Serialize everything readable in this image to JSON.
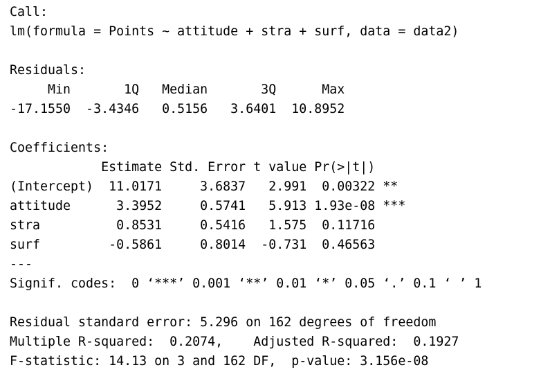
{
  "console": {
    "lines": [
      "Call:",
      "lm(formula = Points ~ attitude + stra + surf, data = data2)",
      "",
      "Residuals:",
      "     Min       1Q   Median       3Q      Max ",
      "-17.1550  -3.4346   0.5156   3.6401  10.8952 ",
      "",
      "Coefficients:",
      "            Estimate Std. Error t value Pr(>|t|)    ",
      "(Intercept)  11.0171     3.6837   2.991  0.00322 ** ",
      "attitude      3.3952     0.5741   5.913 1.93e-08 ***",
      "stra          0.8531     0.5416   1.575  0.11716    ",
      "surf         -0.5861     0.8014  -0.731  0.46563    ",
      "---",
      "Signif. codes:  0 ‘***’ 0.001 ‘**’ 0.01 ‘*’ 0.05 ‘.’ 0.1 ‘ ’ 1",
      "",
      "Residual standard error: 5.296 on 162 degrees of freedom",
      "Multiple R-squared:  0.2074,    Adjusted R-squared:  0.1927 ",
      "F-statistic: 14.13 on 3 and 162 DF,  p-value: 3.156e-08"
    ]
  }
}
